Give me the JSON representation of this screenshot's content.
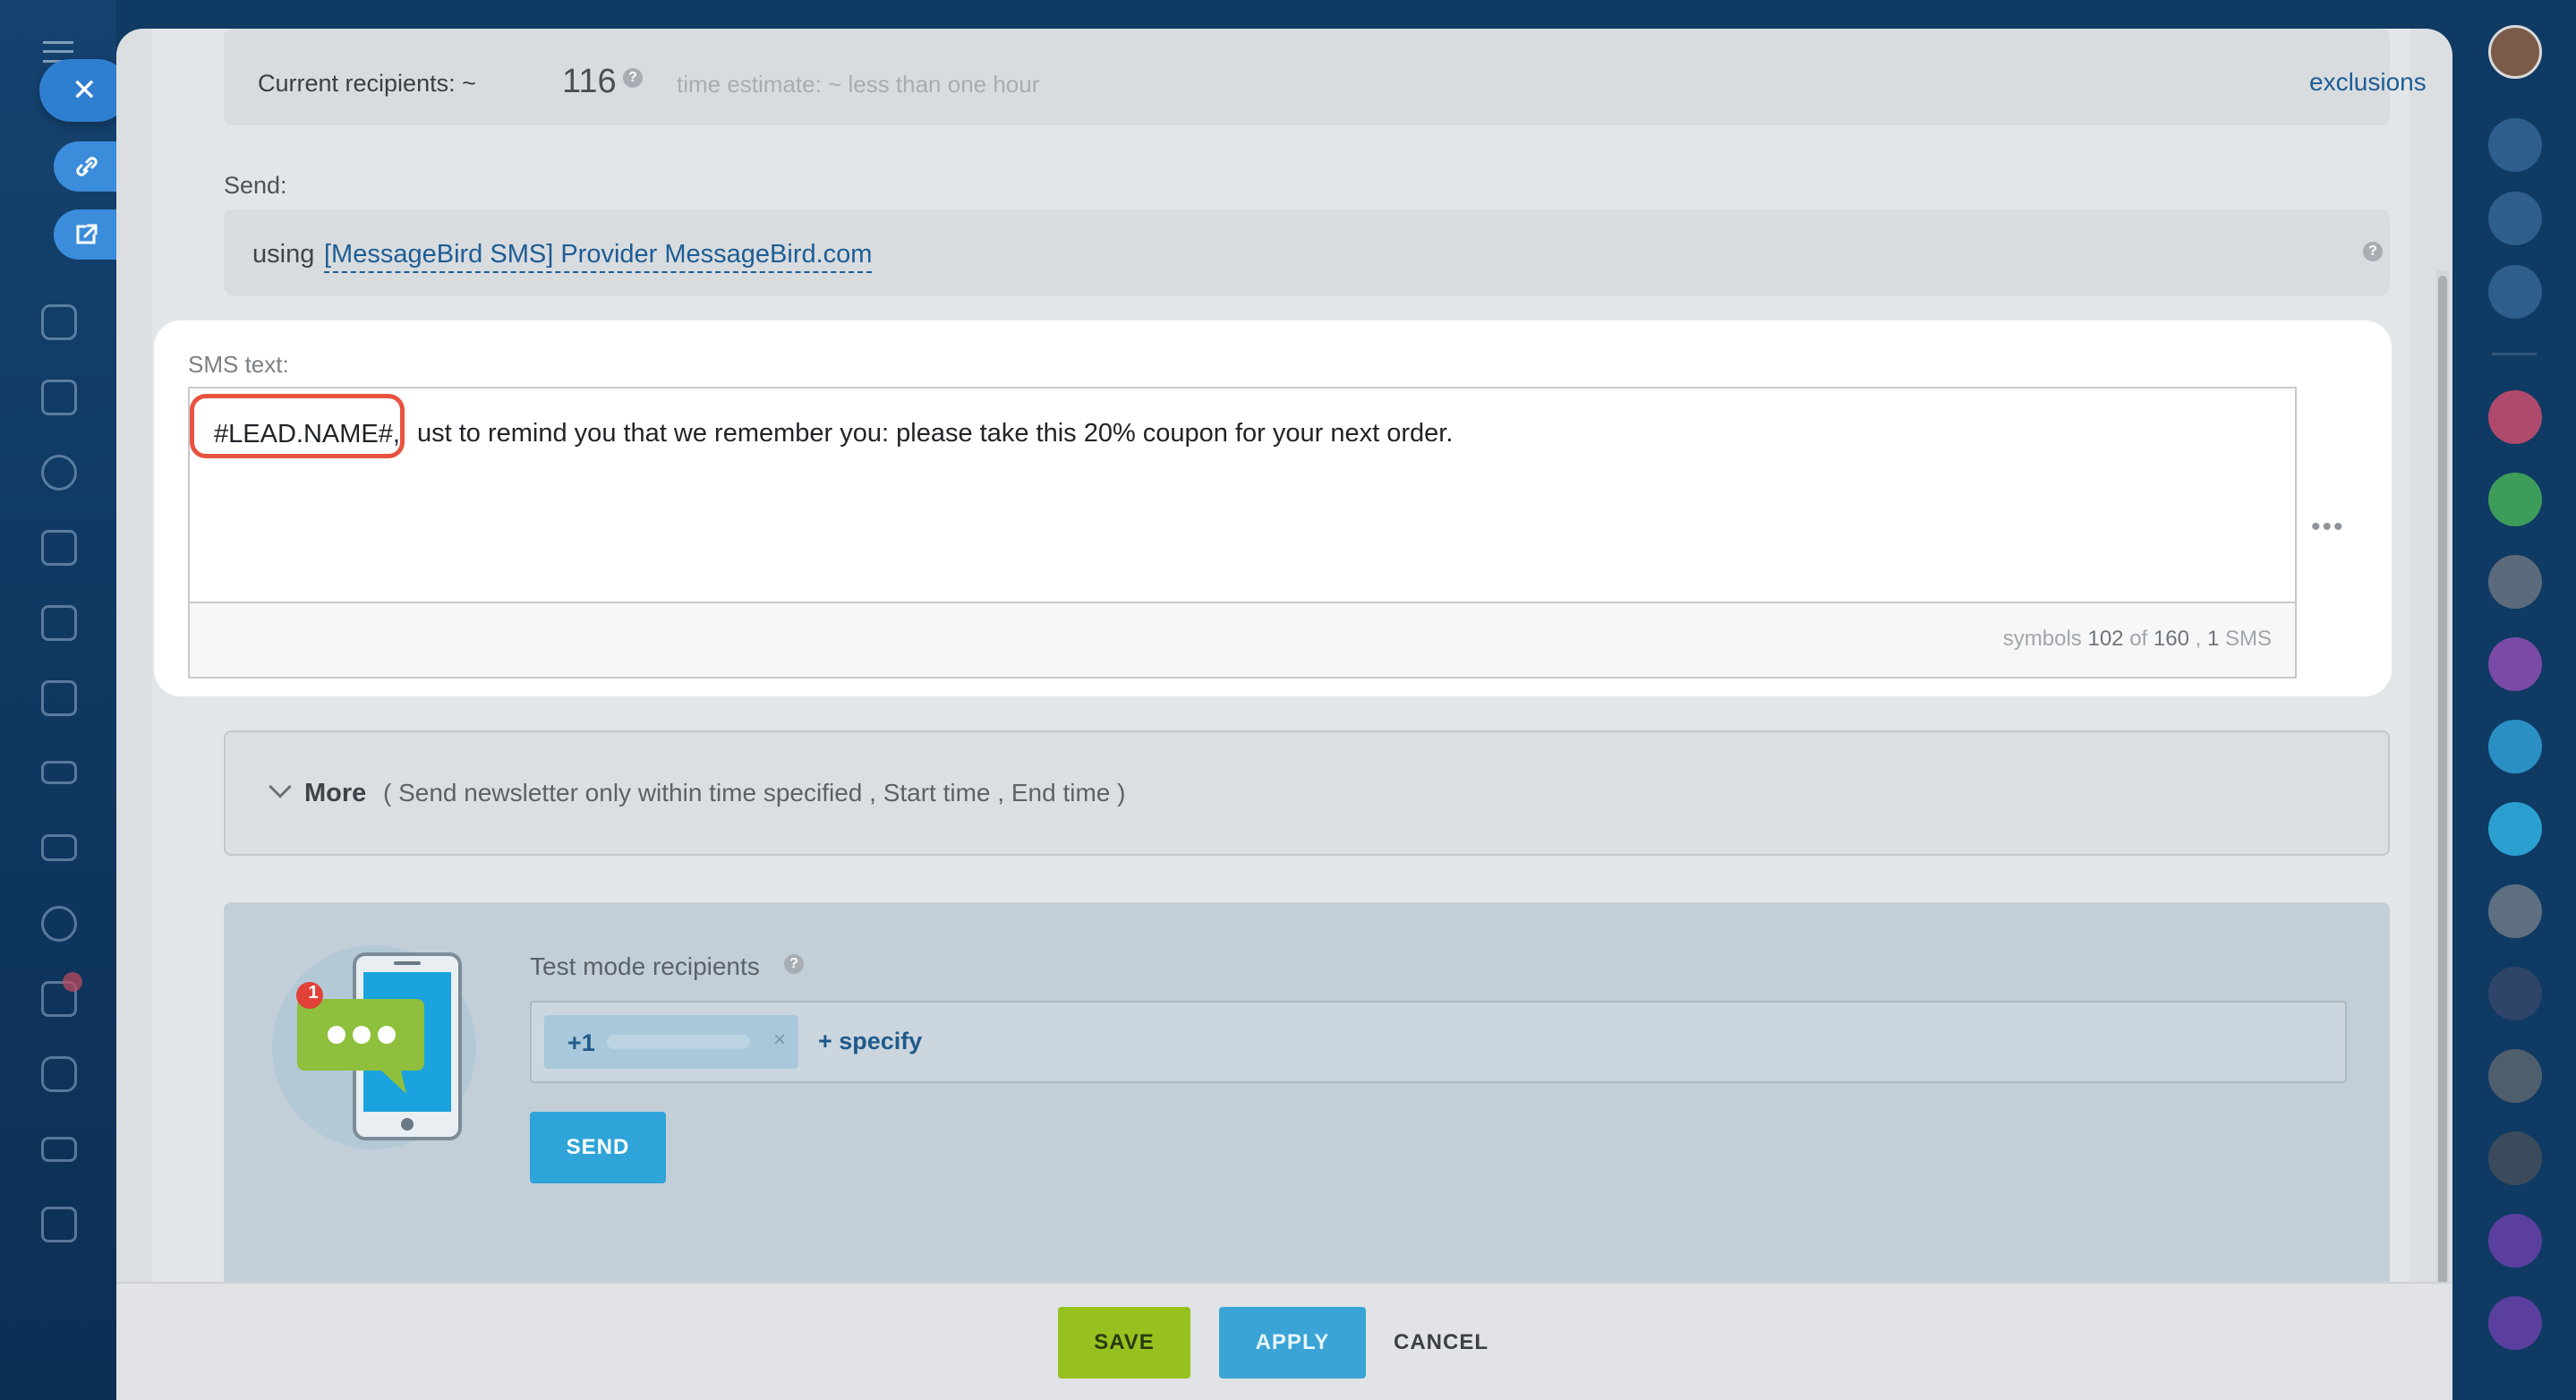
{
  "recipients": {
    "label": "Current recipients: ~",
    "count": "116",
    "help": "?",
    "estimate": "time estimate: ~ less than one hour",
    "exclusions": "exclusions"
  },
  "send": {
    "label": "Send:",
    "using": "using",
    "provider": "[MessageBird SMS] Provider MessageBird.com",
    "help": "?"
  },
  "sms": {
    "label": "SMS text:",
    "token": "#LEAD.NAME#,",
    "text": "ust to remind you that we remember you: please take this 20% coupon for your next order.",
    "counter_prefix": "symbols",
    "counter_used": "102",
    "counter_of": "of",
    "counter_max": "160",
    "counter_sep": ",",
    "counter_sms_count": "1",
    "counter_sms_label": "SMS",
    "more_dots": "•••"
  },
  "more": {
    "label": "More",
    "detail": "( Send newsletter only within time specified ,   Start time ,   End time   )"
  },
  "test": {
    "label": "Test mode recipients",
    "help": "?",
    "chip_prefix": "+1",
    "chip_remove": "×",
    "specify": "+ specify",
    "send_button": "SEND",
    "notification_count": "1"
  },
  "buttons": {
    "save": "SAVE",
    "apply": "APPLY",
    "cancel": "CANCEL"
  },
  "colors": {
    "highlight": "#e8533f",
    "link": "#1d5d95",
    "save": "#97c11e",
    "apply": "#3aa4d6"
  }
}
